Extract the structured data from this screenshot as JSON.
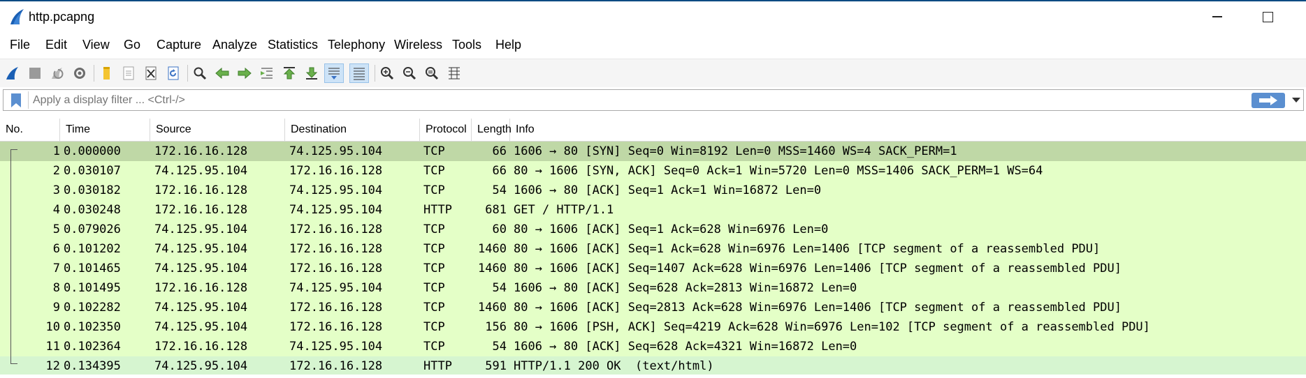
{
  "window": {
    "title": "http.pcapng"
  },
  "menu": [
    "File",
    "Edit",
    "View",
    "Go",
    "Capture",
    "Analyze",
    "Statistics",
    "Telephony",
    "Wireless",
    "Tools",
    "Help"
  ],
  "toolbar": {
    "icons": [
      "shark-fin-start-icon",
      "stop-capture-icon",
      "restart-capture-icon",
      "capture-options-icon",
      "open-file-icon",
      "save-file-icon",
      "close-file-icon",
      "reload-file-icon",
      "find-packet-icon",
      "go-back-icon",
      "go-forward-icon",
      "go-to-packet-icon",
      "first-packet-icon",
      "last-packet-icon",
      "autoscroll-icon",
      "colorize-icon",
      "zoom-in-icon",
      "zoom-out-icon",
      "normal-size-icon",
      "resize-columns-icon"
    ]
  },
  "filter": {
    "placeholder": "Apply a display filter ... <Ctrl-/>",
    "value": ""
  },
  "columns": [
    "No.",
    "Time",
    "Source",
    "Destination",
    "Protocol",
    "Length",
    "Info"
  ],
  "packets": [
    {
      "no": "1",
      "time": "0.000000",
      "source": "172.16.16.128",
      "destination": "74.125.95.104",
      "protocol": "TCP",
      "length": "66",
      "info": "1606 → 80 [SYN] Seq=0 Win=8192 Len=0 MSS=1460 WS=4 SACK_PERM=1"
    },
    {
      "no": "2",
      "time": "0.030107",
      "source": "74.125.95.104",
      "destination": "172.16.16.128",
      "protocol": "TCP",
      "length": "66",
      "info": "80 → 1606 [SYN, ACK] Seq=0 Ack=1 Win=5720 Len=0 MSS=1406 SACK_PERM=1 WS=64"
    },
    {
      "no": "3",
      "time": "0.030182",
      "source": "172.16.16.128",
      "destination": "74.125.95.104",
      "protocol": "TCP",
      "length": "54",
      "info": "1606 → 80 [ACK] Seq=1 Ack=1 Win=16872 Len=0"
    },
    {
      "no": "4",
      "time": "0.030248",
      "source": "172.16.16.128",
      "destination": "74.125.95.104",
      "protocol": "HTTP",
      "length": "681",
      "info": "GET / HTTP/1.1"
    },
    {
      "no": "5",
      "time": "0.079026",
      "source": "74.125.95.104",
      "destination": "172.16.16.128",
      "protocol": "TCP",
      "length": "60",
      "info": "80 → 1606 [ACK] Seq=1 Ack=628 Win=6976 Len=0"
    },
    {
      "no": "6",
      "time": "0.101202",
      "source": "74.125.95.104",
      "destination": "172.16.16.128",
      "protocol": "TCP",
      "length": "1460",
      "info": "80 → 1606 [ACK] Seq=1 Ack=628 Win=6976 Len=1406 [TCP segment of a reassembled PDU]"
    },
    {
      "no": "7",
      "time": "0.101465",
      "source": "74.125.95.104",
      "destination": "172.16.16.128",
      "protocol": "TCP",
      "length": "1460",
      "info": "80 → 1606 [ACK] Seq=1407 Ack=628 Win=6976 Len=1406 [TCP segment of a reassembled PDU]"
    },
    {
      "no": "8",
      "time": "0.101495",
      "source": "172.16.16.128",
      "destination": "74.125.95.104",
      "protocol": "TCP",
      "length": "54",
      "info": "1606 → 80 [ACK] Seq=628 Ack=2813 Win=16872 Len=0"
    },
    {
      "no": "9",
      "time": "0.102282",
      "source": "74.125.95.104",
      "destination": "172.16.16.128",
      "protocol": "TCP",
      "length": "1460",
      "info": "80 → 1606 [ACK] Seq=2813 Ack=628 Win=6976 Len=1406 [TCP segment of a reassembled PDU]"
    },
    {
      "no": "10",
      "time": "0.102350",
      "source": "74.125.95.104",
      "destination": "172.16.16.128",
      "protocol": "TCP",
      "length": "156",
      "info": "80 → 1606 [PSH, ACK] Seq=4219 Ack=628 Win=6976 Len=102 [TCP segment of a reassembled PDU]"
    },
    {
      "no": "11",
      "time": "0.102364",
      "source": "172.16.16.128",
      "destination": "74.125.95.104",
      "protocol": "TCP",
      "length": "54",
      "info": "1606 → 80 [ACK] Seq=628 Ack=4321 Win=16872 Len=0"
    },
    {
      "no": "12",
      "time": "0.134395",
      "source": "74.125.95.104",
      "destination": "172.16.16.128",
      "protocol": "HTTP",
      "length": "591",
      "info": "HTTP/1.1 200 OK  (text/html)"
    }
  ],
  "colors": {
    "tcp_row": "#e4ffc7",
    "selected_row": "#bfd8a6",
    "http_response_row": "#d6f5d0",
    "accent": "#5b8fd0"
  }
}
